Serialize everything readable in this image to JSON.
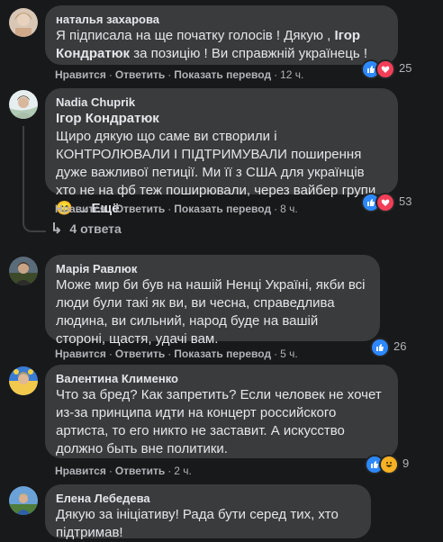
{
  "action_labels": {
    "like": "Нравится",
    "reply": "Ответить",
    "translate": "Показать перевод"
  },
  "comments": [
    {
      "author": "наталья захарова",
      "text_before": "Я підписала на ще початку голосів ! Дякую , ",
      "mention": "Ігор Кондратюк",
      "text_after": " за позицію ! Ви справжній українець !",
      "time": "12 ч.",
      "reaction_count": "25",
      "reactions": [
        "like-icon",
        "love-icon"
      ]
    },
    {
      "author": "Nadia Chuprik",
      "mention": "Ігор Кондратюк",
      "text": "Щиро дякую що саме ви створили і КОНТРОЛЮВАЛИ І ПІДТРИМУВАЛИ поширення дуже важливої петиції. Ми її з США для українців хто не на фб теж поширювали, через вайбер групи 😊 ...",
      "more": "Ещё",
      "time": "8 ч.",
      "reaction_count": "53",
      "reactions": [
        "like-icon",
        "love-icon"
      ]
    },
    {
      "author": "Марія Равлюк",
      "text": "Може мир би був на нашій Ненці Україні, якби всі люди були такі як ви, ви чесна, справедлива людина, ви сильний, народ буде на вашій стороні, щастя, удачі вам.",
      "time": "5 ч.",
      "reaction_count": "26",
      "reactions": [
        "like-icon"
      ]
    },
    {
      "author": "Валентина Клименко",
      "text": "Что за бред? Как запретить? Если человек не хочет из-за принципа идти на концерт российского артиста, то его никто не заставит. А искусство должно быть вне политики.",
      "time": "2 ч.",
      "reaction_count": "9",
      "reactions": [
        "like-icon",
        "haha-icon"
      ]
    },
    {
      "author": "Елена Лебедева",
      "text": "Дякую за ініціативу! Рада бути серед тих, хто підтримав!"
    }
  ],
  "replies_label": "4 ответа",
  "colors": {
    "background": "#18191a",
    "bubble": "#3a3b3c",
    "like": "#2d88ff",
    "love": "#f33e58",
    "haha": "#f7b125"
  }
}
